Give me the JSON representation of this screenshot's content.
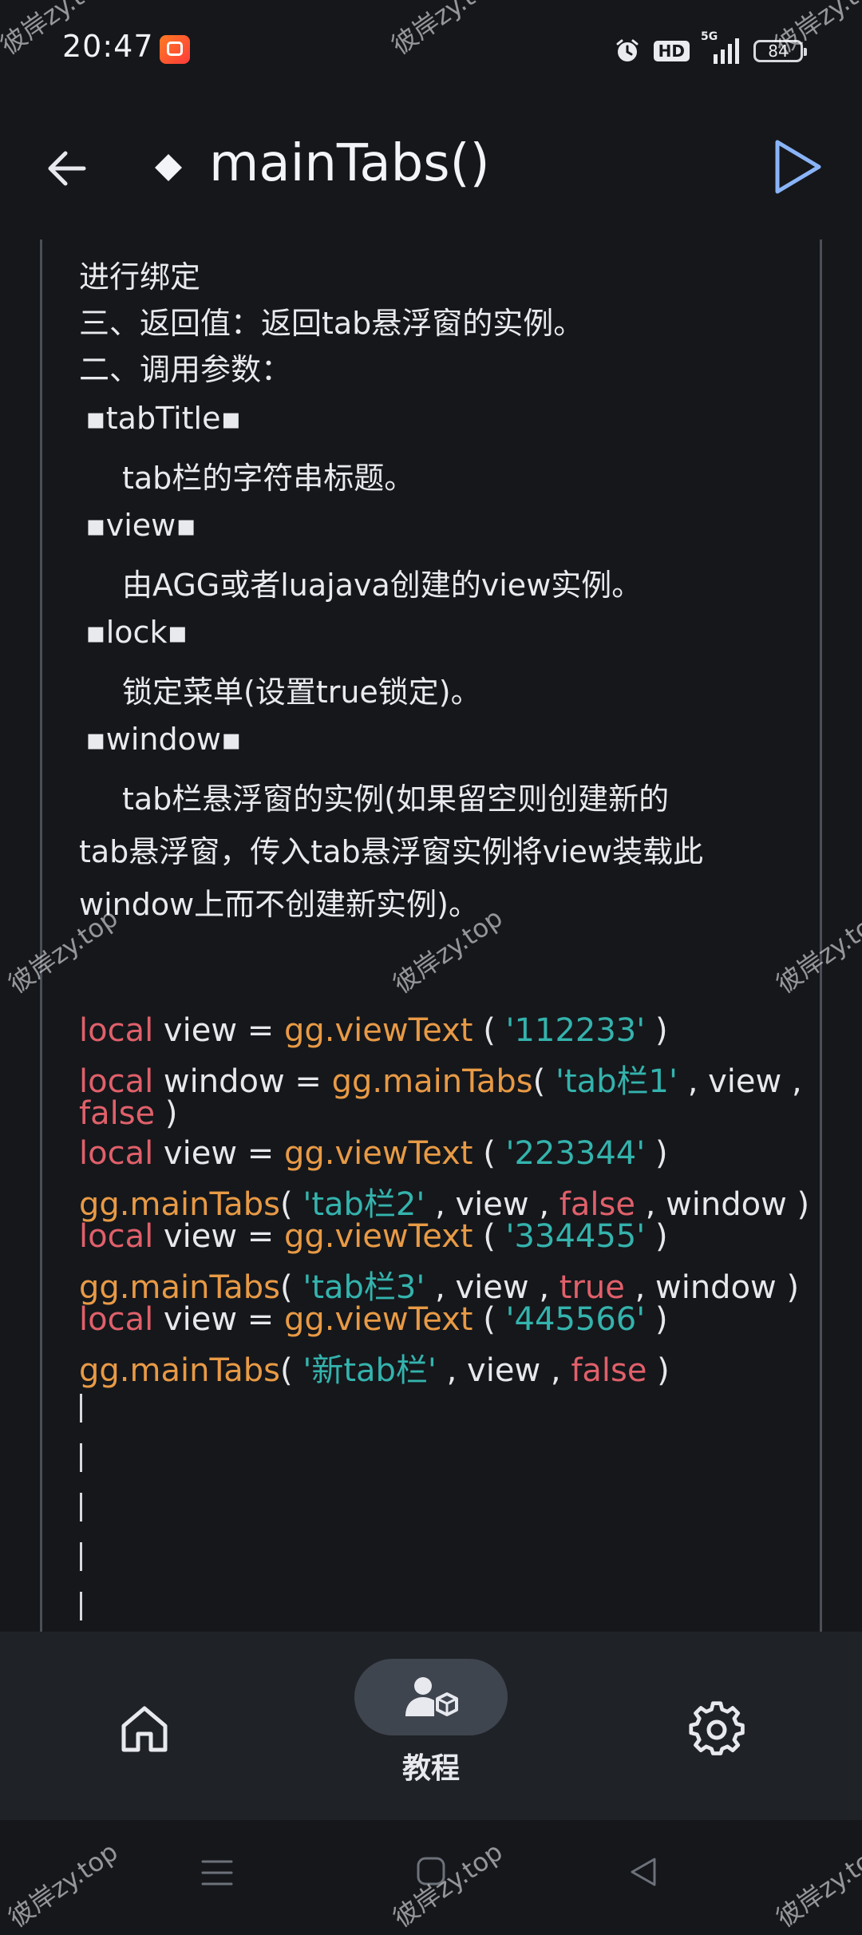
{
  "status_bar": {
    "time": "20:47",
    "hd_label": "HD",
    "network_label": "5G",
    "battery": "84"
  },
  "header": {
    "title": "mainTabs()"
  },
  "doc": {
    "lines": [
      "进行绑定",
      " 三、返回值：返回tab悬浮窗的实例。",
      " 二、调用参数：",
      "▪tabTitle▪",
      "tab栏的字符串标题。",
      "▪view▪",
      "由AGG或者luajava创建的view实例。",
      "▪lock▪",
      "锁定菜单(设置true锁定)。",
      "▪window▪",
      "tab栏悬浮窗的实例(如果留空则创建新的",
      "tab悬浮窗，传入tab悬浮窗实例将view装载此",
      "window上而不创建新实例)。"
    ]
  },
  "code": {
    "line1": {
      "kw": "local",
      "a": " view = ",
      "fn": "gg.viewText",
      "b": " ( ",
      "str": "'112233'",
      "c": " )"
    },
    "line2": {
      "kw": "local",
      "a": " window = ",
      "fn": "gg.mainTabs",
      "b": "( ",
      "str": "'tab栏1'",
      "c": " , view ,"
    },
    "line3": {
      "kw": "false",
      "c": " )"
    },
    "line4": {
      "kw": "local",
      "a": " view = ",
      "fn": "gg.viewText",
      "b": " ( ",
      "str": "'223344'",
      "c": " )"
    },
    "line5": {
      "fn": "gg.mainTabs",
      "b": "( ",
      "str": "'tab栏2'",
      "a": " , view , ",
      "kw": "false",
      "c": " , window )"
    },
    "line6": {
      "kw": "local",
      "a": " view = ",
      "fn": "gg.viewText",
      "b": " ( ",
      "str": "'334455'",
      "c": " )"
    },
    "line7": {
      "fn": "gg.mainTabs",
      "b": "( ",
      "str": "'tab栏3'",
      "a": " , view , ",
      "kw": "true",
      "c": " , window )"
    },
    "line8": {
      "kw": "local",
      "a": " view = ",
      "fn": "gg.viewText",
      "b": " ( ",
      "str": "'445566'",
      "c": " )"
    },
    "line9": {
      "fn": "gg.mainTabs",
      "b": "( ",
      "str": "'新tab栏'",
      "a": " , view , ",
      "kw": "false",
      "c": " )"
    }
  },
  "bottom_nav": {
    "tutorial_label": "教程"
  },
  "watermark": {
    "text": "彼岸zy.top"
  },
  "colors": {
    "background": "#15171b",
    "keyword": "#e0606a",
    "function": "#e89a45",
    "string": "#34b3ad",
    "accent_play": "#8ab4f8"
  },
  "icons": [
    "back-arrow-icon",
    "diamond-icon",
    "play-icon",
    "home-icon",
    "tutorial-icon",
    "settings-icon",
    "alarm-icon",
    "signal-icon",
    "battery-icon",
    "menu-icon",
    "home-square-icon",
    "back-triangle-icon"
  ]
}
